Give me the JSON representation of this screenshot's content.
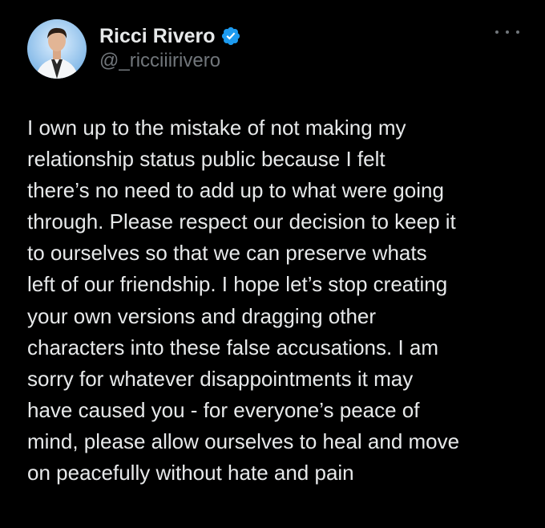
{
  "author": {
    "display_name": "Ricci Rivero",
    "handle": "@_ricciiirivero",
    "verified_icon": "verified-badge-icon",
    "verified_color": "#1d9bf0"
  },
  "menu": {
    "icon": "more-options-icon"
  },
  "tweet": {
    "lines": [
      "I own up to the mistake of not making my",
      "relationship status public because I felt",
      "there’s no need to add up to what were going",
      "through. Please respect our decision to keep it",
      "to ourselves so that we can preserve whats",
      "left of our friendship. I hope let’s stop creating",
      "your own versions and dragging other",
      "characters into these false accusations. I am",
      "sorry for whatever disappointments it may",
      "have caused you - for everyone’s peace of",
      "mind, please allow ourselves to heal and move",
      "on peacefully without hate and pain"
    ]
  },
  "colors": {
    "background": "#000000",
    "text": "#e7e9ea",
    "secondary": "#71767b"
  }
}
